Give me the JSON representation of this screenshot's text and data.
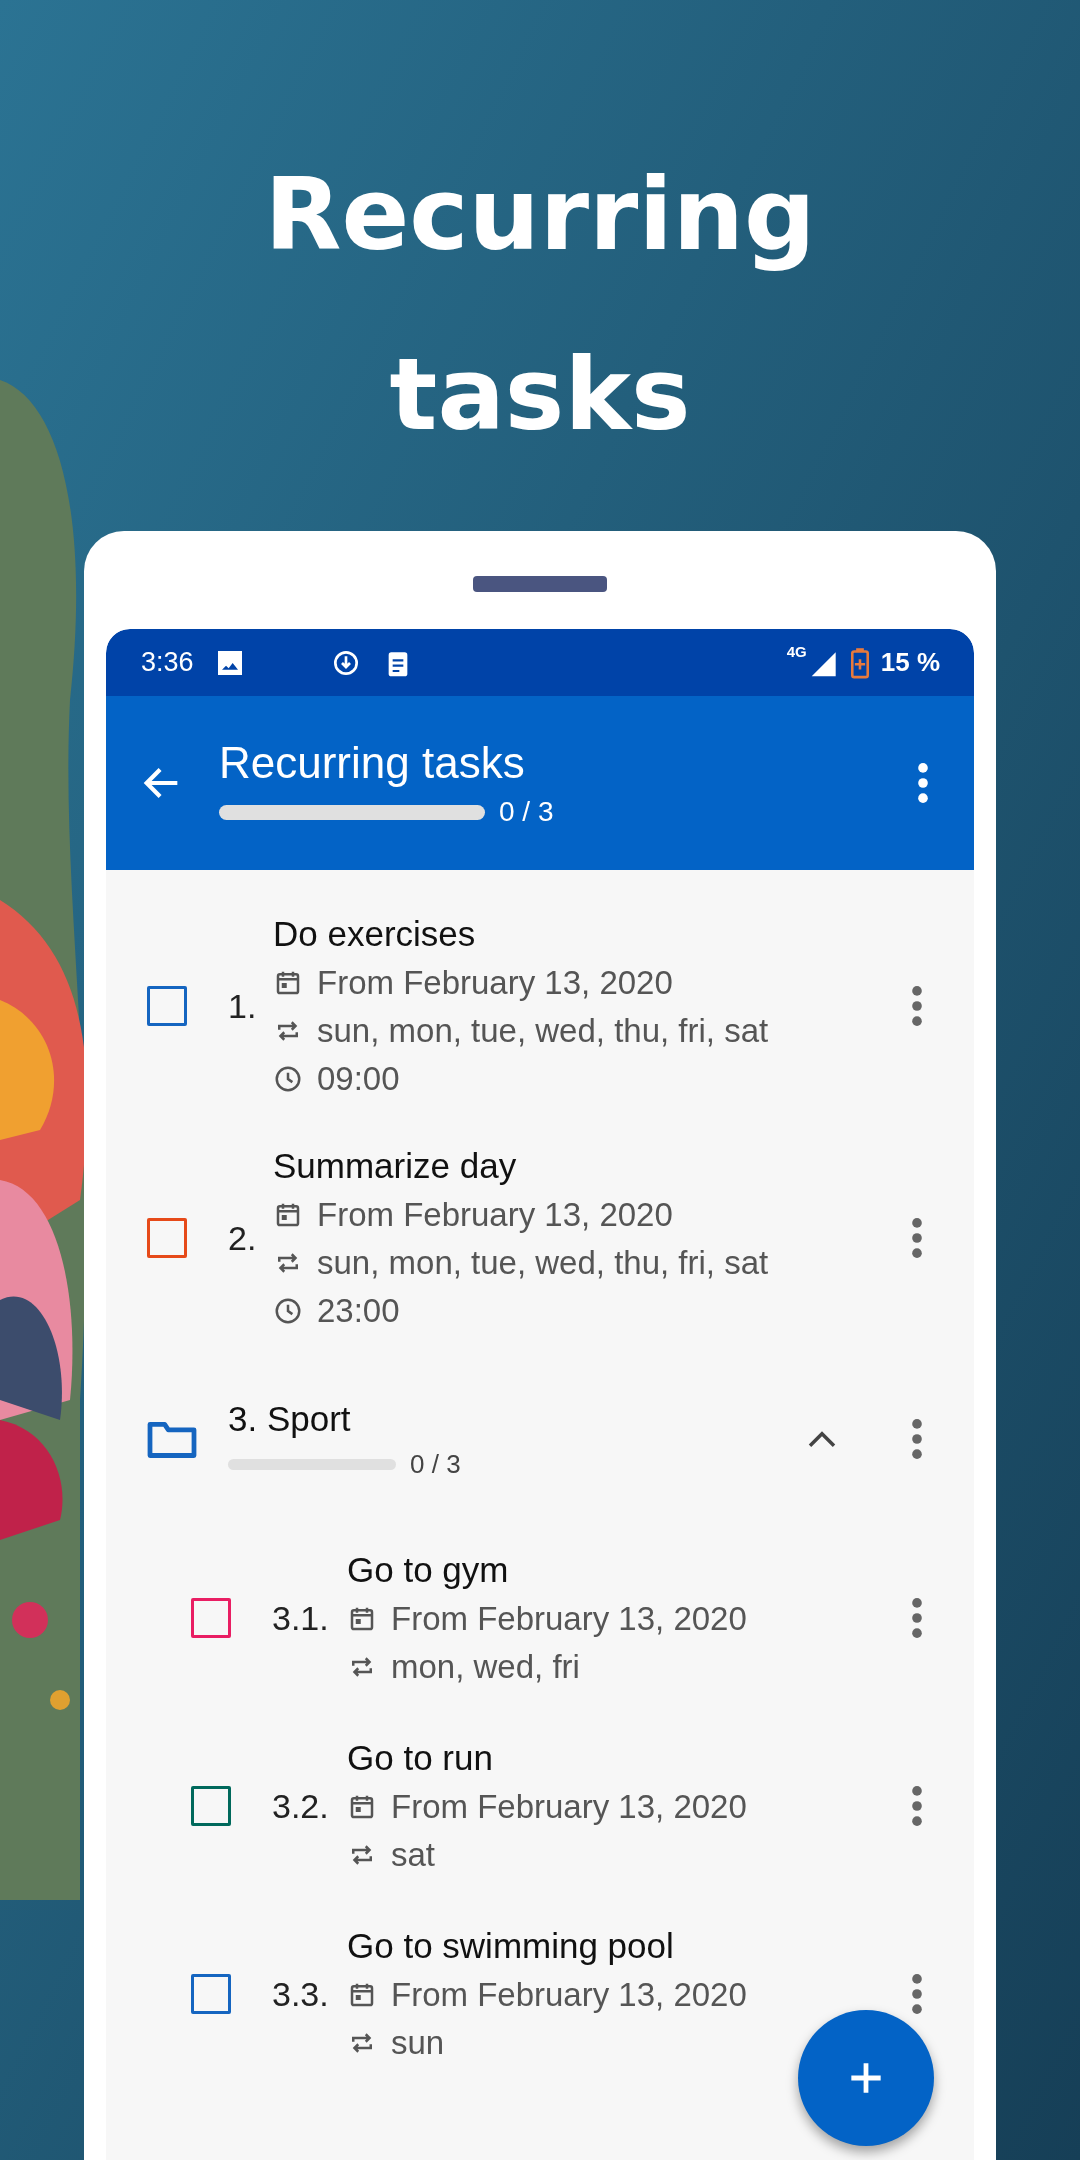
{
  "headline": "Recurring tasks",
  "status_bar": {
    "time": "3:36",
    "network": "4G",
    "battery": "15 %"
  },
  "app_bar": {
    "title": "Recurring tasks",
    "progress": {
      "level": 0,
      "reading": "0 / 3"
    }
  },
  "items": [
    {
      "kind": "task",
      "number": "1.",
      "title": "Do exercises",
      "checked": false,
      "color": "#1565c0",
      "date": "From February 13, 2020",
      "repeat": "sun, mon, tue, wed, thu, fri, sat",
      "time": "09:00"
    },
    {
      "kind": "task",
      "number": "2.",
      "title": "Summarize day",
      "checked": false,
      "color": "#e64a19",
      "date": "From February 13, 2020",
      "repeat": "sun, mon, tue, wed, thu, fri, sat",
      "time": "23:00"
    },
    {
      "kind": "folder",
      "number": "3.",
      "title": "Sport",
      "expanded": true,
      "progress": {
        "level": 0,
        "reading": "0 / 3"
      },
      "children": [
        {
          "kind": "task",
          "number": "3.1.",
          "title": "Go to gym",
          "checked": false,
          "color": "#e91e63",
          "date": "From February 13, 2020",
          "repeat": "mon, wed, fri"
        },
        {
          "kind": "task",
          "number": "3.2.",
          "title": "Go to run",
          "checked": false,
          "color": "#00695c",
          "date": "From February 13, 2020",
          "repeat": "sat"
        },
        {
          "kind": "task",
          "number": "3.3.",
          "title": "Go to swimming pool",
          "checked": false,
          "color": "#1565c0",
          "date": "From February 13, 2020",
          "repeat": "sun"
        }
      ]
    }
  ]
}
